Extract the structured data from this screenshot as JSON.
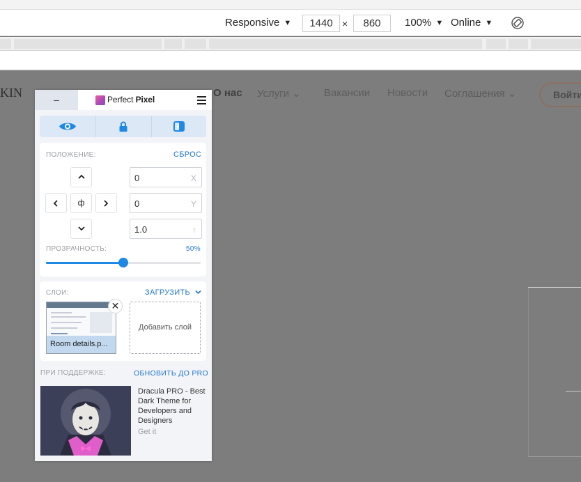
{
  "devtools": {
    "device_mode": "Responsive",
    "width": "1440",
    "height": "860",
    "times": "×",
    "zoom": "100%",
    "throttle": "Online",
    "caret": "▼"
  },
  "site": {
    "logo_fragment": "KIN",
    "nav": [
      "О нас",
      "Услуги ⌄",
      "Вакансии",
      "Новости",
      "Соглашения ⌄"
    ],
    "login": "Войти"
  },
  "panel": {
    "minimize": "–",
    "brand_light": "Perfect ",
    "brand_bold": "Pixel",
    "position_label": "ПОЛОЖЕНИЕ:",
    "reset_label": "СБРОС",
    "center_label": "ф",
    "x_value": "0",
    "x_unit": "X",
    "y_value": "0",
    "y_unit": "Y",
    "scale_value": "1.0",
    "scale_unit": "↑",
    "opacity_label": "ПРОЗРАЧНОСТЬ:",
    "opacity_value": "50%",
    "opacity_level": 0.5,
    "layers_label": "СЛОИ:",
    "upload_label": "ЗАГРУЗИТЬ",
    "layer_name": "Room details.p...",
    "close_label": "✕",
    "add_layer": "Добавить слой",
    "support_label": "ПРИ ПОДДЕРЖКЕ:",
    "upgrade_label": "ОБНОВИТЬ ДО PRO",
    "ad_text": "Dracula PRO - Best Dark Theme for Developers and Designers",
    "ad_link": "Get it"
  },
  "colors": {
    "accent": "#1e88e5",
    "link": "#2176d3",
    "overlay": "#7d7d7d"
  },
  "icons": [
    "eye-icon",
    "lock-icon",
    "invert-icon",
    "hamburger-icon",
    "rotate-icon",
    "chevron-up-icon",
    "chevron-down-icon",
    "chevron-left-icon",
    "chevron-right-icon"
  ]
}
